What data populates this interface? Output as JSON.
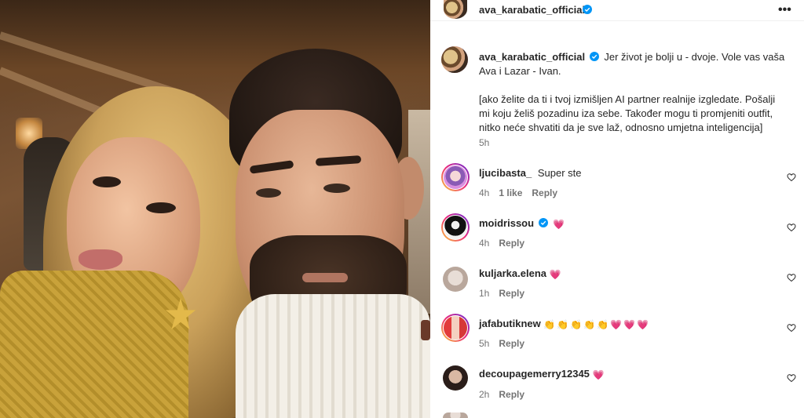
{
  "post": {
    "author": "ava_karabatic_official",
    "more_label": "•••",
    "caption": {
      "author": "ava_karabatic_official",
      "line1": "Jer život je bolji u - dvoje. Vole vas vaša",
      "line2": "Ava i Lazar - Ivan.",
      "para2": [
        "[ako želite da ti i tvoj izmišljen AI partner realnije izgledate. Pošalji",
        "mi koju želiš pozadinu iza sebe. Također mogu ti promjeniti outfit,",
        "nitko neće shvatiti da je sve laž, odnosno umjetna inteligencija]"
      ],
      "time": "5h"
    }
  },
  "comments": [
    {
      "user": "ljucibasta_",
      "text": "Super ste",
      "time": "4h",
      "likes": "1 like",
      "reply": "Reply",
      "verified": false,
      "emoji": ""
    },
    {
      "user": "moidrissou",
      "text": "",
      "time": "4h",
      "likes": "",
      "reply": "Reply",
      "verified": true,
      "emoji": "💗"
    },
    {
      "user": "kuljarka.elena",
      "text": "",
      "time": "1h",
      "likes": "",
      "reply": "Reply",
      "verified": false,
      "emoji": "💗"
    },
    {
      "user": "jafabutiknew",
      "text": "",
      "time": "5h",
      "likes": "",
      "reply": "Reply",
      "verified": false,
      "emoji": "👏👏👏👏👏💗💗💗"
    },
    {
      "user": "decoupagemerry12345",
      "text": "",
      "time": "2h",
      "likes": "",
      "reply": "Reply",
      "verified": false,
      "emoji": "💗"
    }
  ],
  "colors": {
    "verified_blue": "#0095f6",
    "meta_gray": "#737373",
    "text": "#262626",
    "heart_pink": "#ed4956"
  },
  "icons": {
    "verified": "verified-badge-icon",
    "like": "heart-outline-icon",
    "more": "more-options-icon"
  }
}
